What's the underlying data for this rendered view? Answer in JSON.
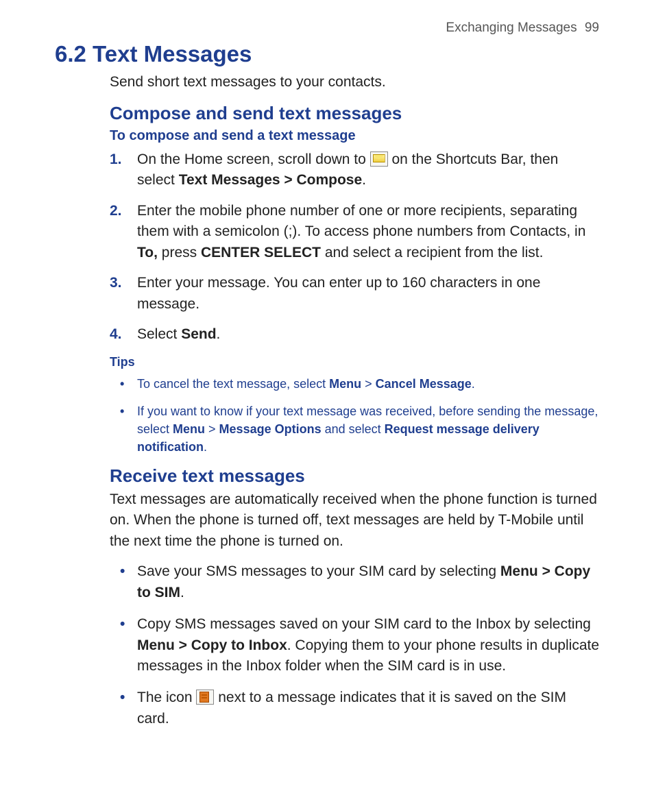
{
  "header": {
    "chapter": "Exchanging Messages",
    "page": "99"
  },
  "title": "6.2 Text Messages",
  "intro": "Send short text messages to your contacts.",
  "compose": {
    "heading": "Compose and send text messages",
    "howto": "To compose and send a text message",
    "steps": [
      {
        "num": "1.",
        "pre": "On the Home screen, scroll down to ",
        "post": " on the Shortcuts Bar, then select ",
        "bold": "Text Messages > Compose",
        "tail": "."
      },
      {
        "num": "2.",
        "text_a": "Enter the mobile phone number of one or more recipients, separating them with a semicolon (;). To access phone numbers from Contacts, in ",
        "b1": "To,",
        "text_b": " press ",
        "b2": "CENTER SELECT",
        "text_c": " and select a recipient from the list."
      },
      {
        "num": "3.",
        "text": "Enter your message. You can enter up to 160 characters in one message."
      },
      {
        "num": "4.",
        "text_a": "Select ",
        "b1": "Send",
        "text_b": "."
      }
    ]
  },
  "tips_label": "Tips",
  "tips": [
    {
      "a": "To cancel the text message, select ",
      "b1": "Menu",
      "sep1": " > ",
      "b2": "Cancel Message",
      "tail": "."
    },
    {
      "a": "If you want to know if your text message was received, before sending the message, select ",
      "b1": "Menu",
      "sep1": " > ",
      "b2": "Message Options",
      "mid": " and select ",
      "b3": "Request message delivery notification",
      "tail": "."
    }
  ],
  "receive": {
    "heading": "Receive text messages",
    "para": "Text messages are automatically received when the phone function is turned on. When the phone is turned off, text messages are held by T-Mobile until the next time the phone is turned on.",
    "bullets": [
      {
        "a": "Save your SMS messages to your SIM card by selecting ",
        "b1": "Menu > Copy to SIM",
        "tail": "."
      },
      {
        "a": "Copy SMS messages saved on your SIM card to the Inbox by selecting ",
        "b1": "Menu > Copy to Inbox",
        "tail": ". Copying them to your phone results in duplicate messages in the Inbox folder when the SIM card is in use."
      },
      {
        "a": "The icon ",
        "post": " next to a message indicates that it is saved on the SIM card."
      }
    ]
  }
}
